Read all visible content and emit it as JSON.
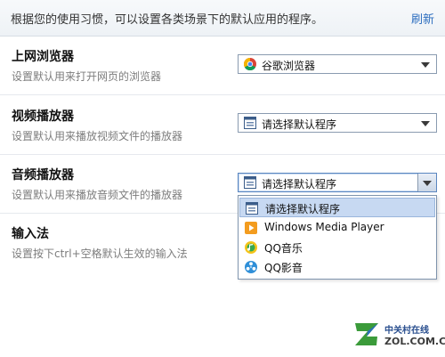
{
  "header": {
    "description": "根据您的使用习惯，可以设置各类场景下的默认应用的程序。",
    "refresh_label": "刷新"
  },
  "settings": [
    {
      "title": "上网浏览器",
      "subtitle": "设置默认用来打开网页的浏览器",
      "selected": "谷歌浏览器",
      "icon": "chrome-icon"
    },
    {
      "title": "视频播放器",
      "subtitle": "设置默认用来播放视频文件的播放器",
      "selected": "请选择默认程序",
      "icon": "program-icon"
    },
    {
      "title": "音频播放器",
      "subtitle": "设置默认用来播放音频文件的播放器",
      "selected": "请选择默认程序",
      "icon": "program-icon"
    },
    {
      "title": "输入法",
      "subtitle": "设置按下ctrl+空格默认生效的输入法"
    }
  ],
  "dropdown": {
    "options": [
      {
        "label": "请选择默认程序",
        "icon": "program-icon",
        "highlighted": true
      },
      {
        "label": "Windows Media Player",
        "icon": "media-player-icon"
      },
      {
        "label": "QQ音乐",
        "icon": "qq-music-icon"
      },
      {
        "label": "QQ影音",
        "icon": "qq-video-icon"
      }
    ]
  },
  "watermark": {
    "cn": "中关村在线",
    "en": "ZOL.COM.CN"
  },
  "colors": {
    "accent": "#2d6ebf",
    "selection": "#c7d9f2"
  }
}
